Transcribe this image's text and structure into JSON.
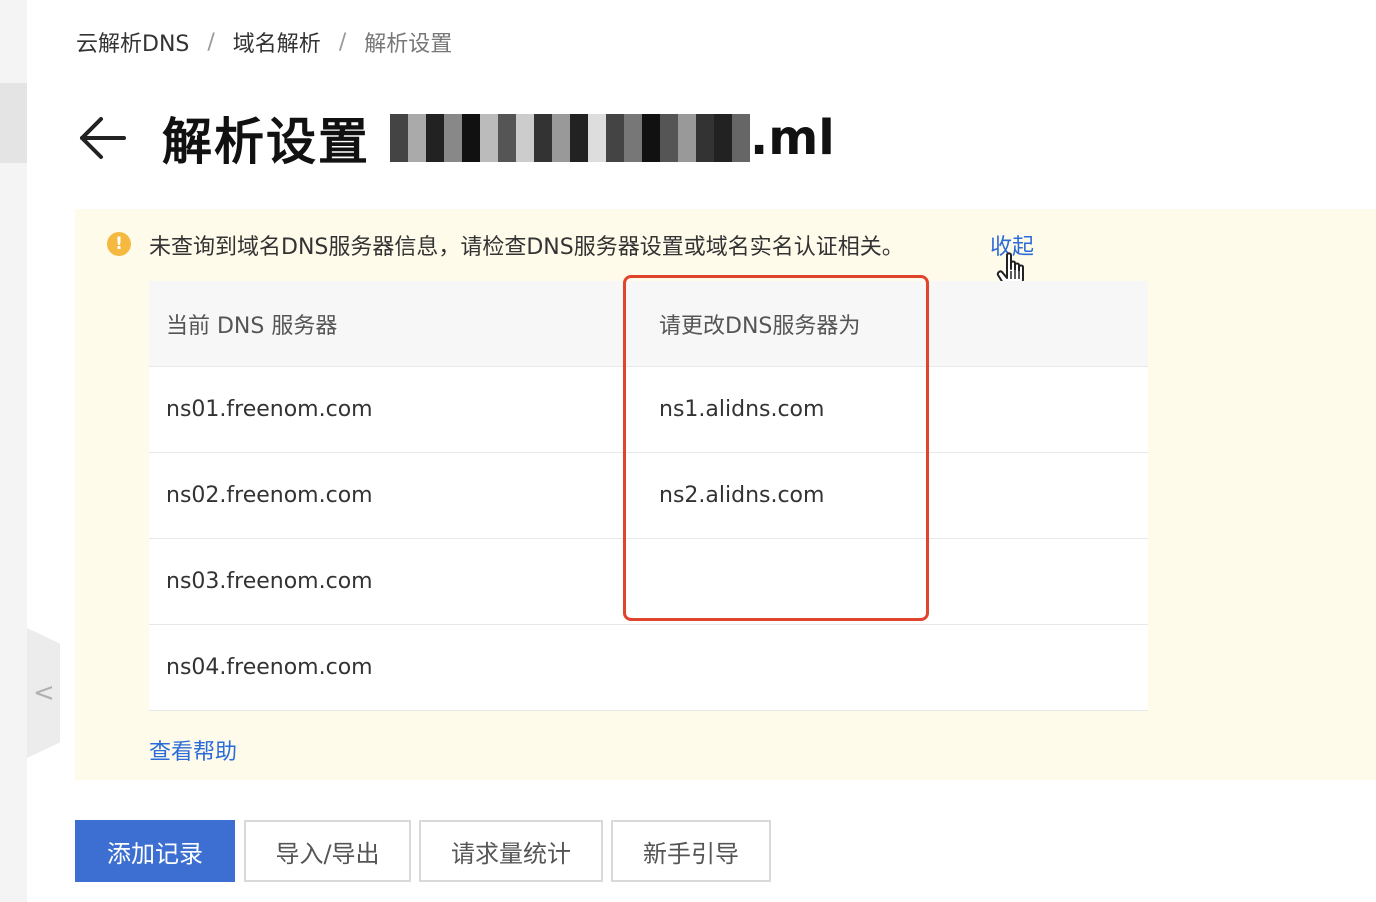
{
  "breadcrumb": {
    "items": [
      "云解析DNS",
      "域名解析",
      "解析设置"
    ],
    "separator": "/"
  },
  "page": {
    "title": "解析设置",
    "domain_suffix": ".ml"
  },
  "notice": {
    "message": "未查询到域名DNS服务器信息，请检查DNS服务器设置或域名实名认证相关。",
    "collapse_label": "收起",
    "help_label": "查看帮助",
    "icon": "exclamation-circle-icon",
    "icon_glyph": "!"
  },
  "ns_table": {
    "headers": [
      "当前 DNS 服务器",
      "请更改DNS服务器为"
    ],
    "rows": [
      [
        "ns01.freenom.com",
        "ns1.alidns.com"
      ],
      [
        "ns02.freenom.com",
        "ns2.alidns.com"
      ],
      [
        "ns03.freenom.com",
        ""
      ],
      [
        "ns04.freenom.com",
        ""
      ]
    ]
  },
  "actions": {
    "add_record": "添加记录",
    "import_export": "导入/导出",
    "request_stats": "请求量统计",
    "guide": "新手引导"
  },
  "sidebar": {
    "collapse_glyph": "<"
  },
  "colors": {
    "primary": "#3c6fd1",
    "link": "#2b6cd8",
    "notice_bg": "#fffbeb",
    "warning": "#f5b940",
    "highlight": "#e0442c"
  }
}
